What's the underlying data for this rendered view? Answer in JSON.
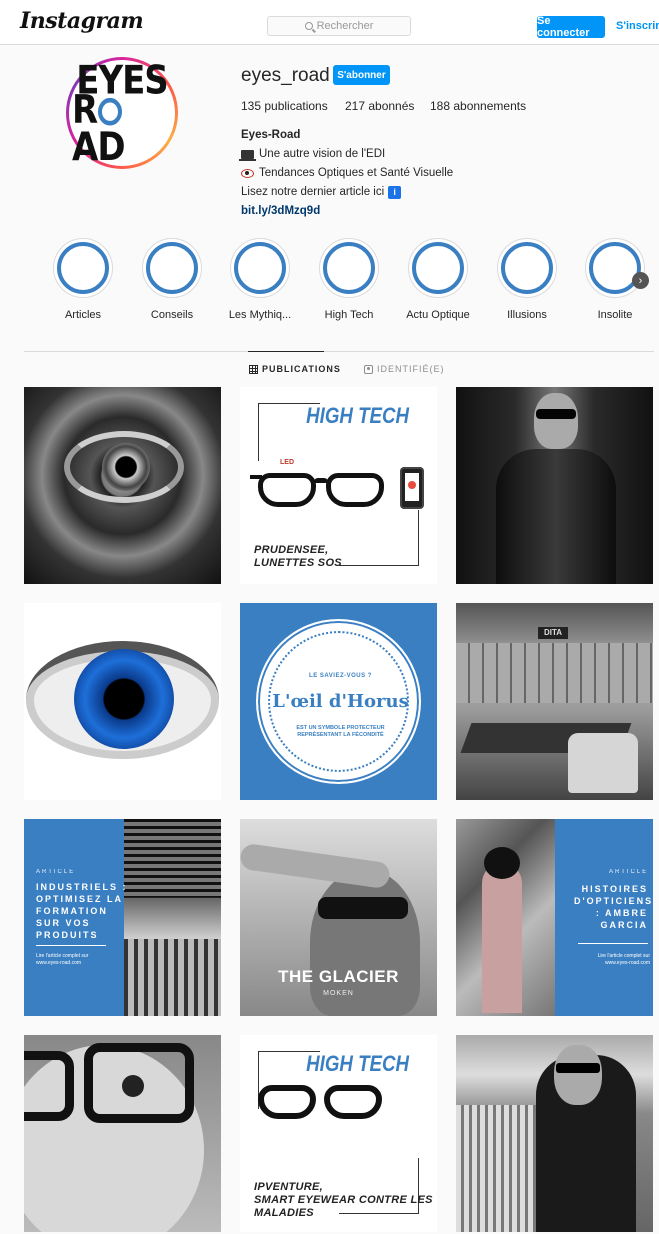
{
  "header": {
    "logo": "Instagram",
    "search_placeholder": "Rechercher",
    "login_label": "Se connecter",
    "signup_label": "S'inscrire"
  },
  "profile": {
    "avatar_line1": "EYES",
    "avatar_line2a": "R",
    "avatar_line2b": "AD",
    "username": "eyes_road",
    "follow_label": "S'abonner",
    "stats": {
      "posts": "135 publications",
      "followers": "217 abonnés",
      "following": "188 abonnements"
    },
    "bio": {
      "name": "Eyes-Road",
      "line1": "Une autre vision de l'EDI",
      "line2": "Tendances Optiques et Santé Visuelle",
      "line3": "Lisez notre dernier article ici",
      "info_glyph": "i",
      "link": "bit.ly/3dMzq9d"
    }
  },
  "highlights": [
    {
      "label": "Articles"
    },
    {
      "label": "Conseils"
    },
    {
      "label": "Les Mythiq..."
    },
    {
      "label": "High Tech"
    },
    {
      "label": "Actu Optique"
    },
    {
      "label": "Illusions"
    },
    {
      "label": "Insolite"
    }
  ],
  "tabs": {
    "publications": "PUBLICATIONS",
    "tagged": "IDENTIFIÉ(E)"
  },
  "posts": {
    "p2": {
      "title": "HIGH TECH",
      "led": "LED",
      "caption": "PRUDENSEE,\nLUNETTES SOS"
    },
    "p5": {
      "top": "LE SAVIEZ-VOUS ?",
      "title": "L'œil d'Horus",
      "sub": "EST UN SYMBOLE PROTECTEUR\nREPRÉSENTANT LA FÉCONDITÉ"
    },
    "p6": {
      "sign": "DITA"
    },
    "p7": {
      "label": "ARTICLE",
      "title": "INDUSTRIELS :\nOPTIMISEZ LA\nFORMATION\nSUR VOS\nPRODUITS",
      "sub": "Lire l'article complet sur\nwww.eyes-road.com"
    },
    "p8": {
      "brand": "THE GLACIER",
      "sub": "MOKEN"
    },
    "p9": {
      "label": "ARTICLE",
      "title": "HISTOIRES\nD'OPTICIENS\n: AMBRE\nGARCIA",
      "sub": "Lire l'article complet sur\nwww.eyes-road.com"
    },
    "p11": {
      "title": "HIGH TECH",
      "caption": "IPVENTURE,\nSMART EYEWEAR CONTRE LES\nMALADIES"
    }
  },
  "colors": {
    "accent": "#0095f6",
    "brand_blue": "#3a7fc2"
  }
}
